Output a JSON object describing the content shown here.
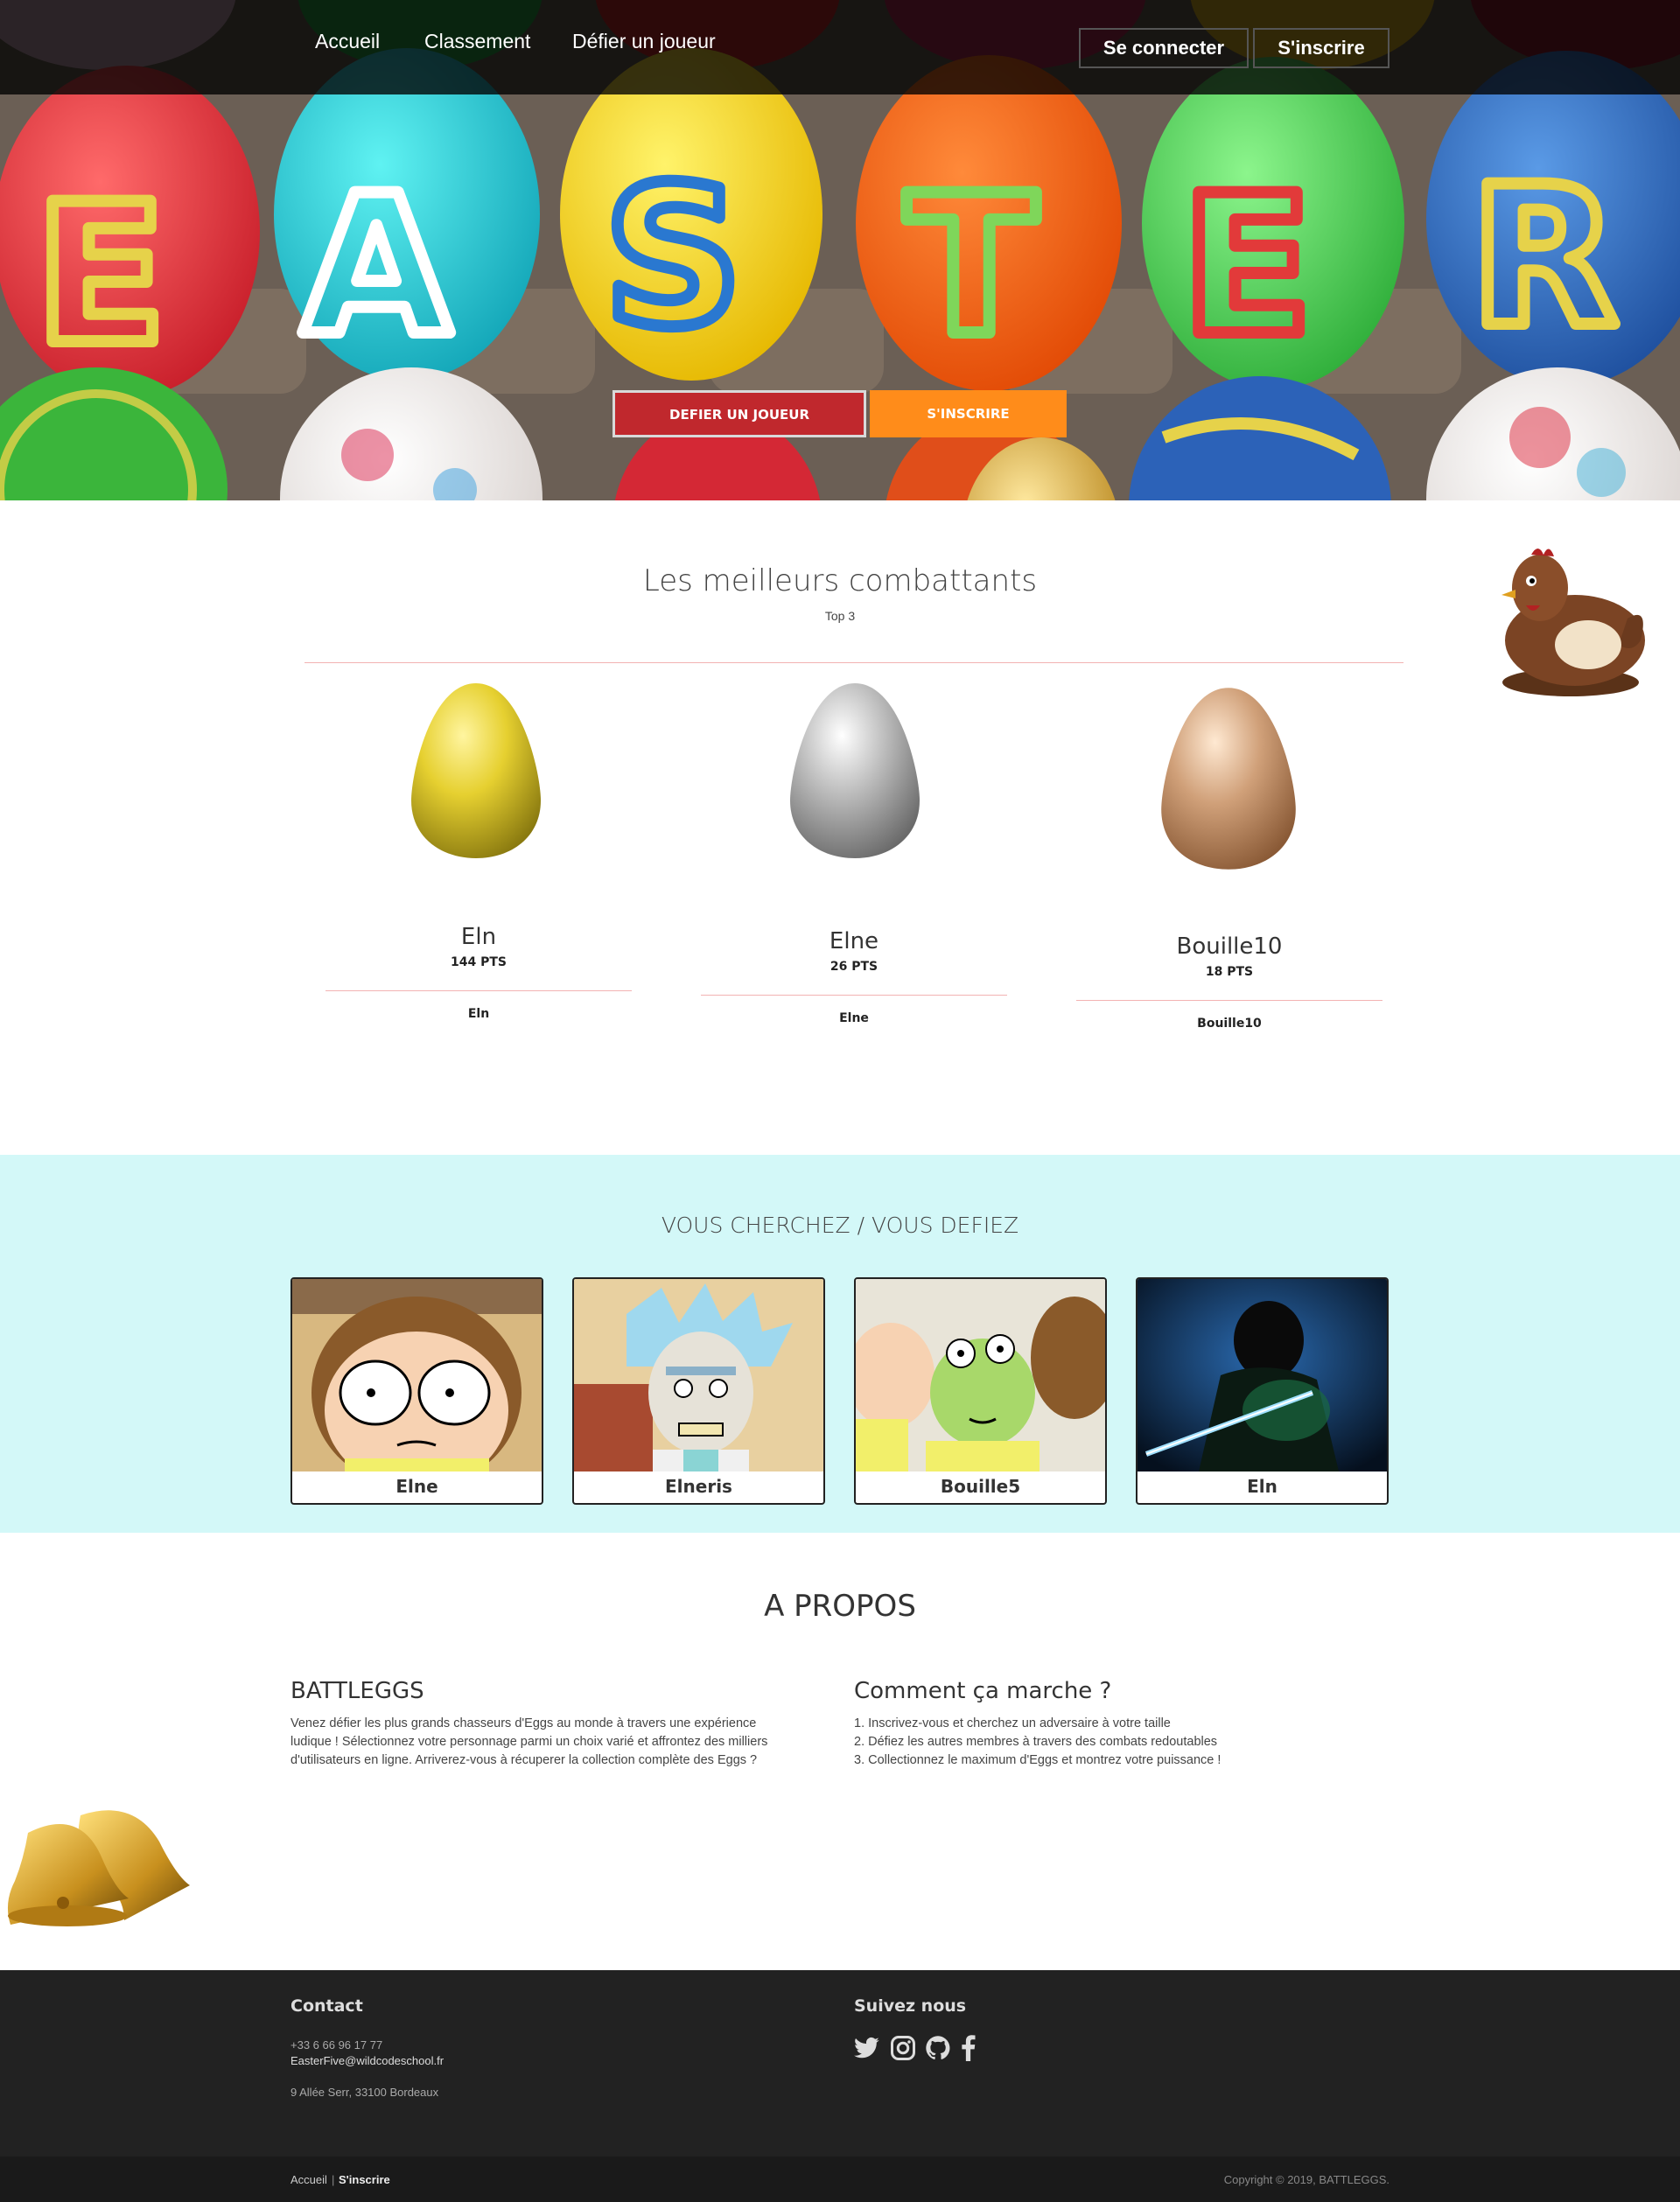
{
  "nav": {
    "links": [
      "Accueil",
      "Classement",
      "Défier un joueur"
    ],
    "login_label": "Se connecter",
    "signup_label": "S'inscrire"
  },
  "hero": {
    "challenge_label": "DEFIER UN JOUEUR",
    "signup_label": "S'INSCRIRE",
    "egg_letters": [
      "E",
      "A",
      "S",
      "T",
      "E",
      "R"
    ]
  },
  "top": {
    "title": "Les meilleurs combattants",
    "subtitle": "Top 3",
    "players": [
      {
        "name": "Eln",
        "points": "144 PTS",
        "sub": "Eln",
        "medal": "gold"
      },
      {
        "name": "Elne",
        "points": "26 PTS",
        "sub": "Elne",
        "medal": "silver"
      },
      {
        "name": "Bouille10",
        "points": "18 PTS",
        "sub": "Bouille10",
        "medal": "bronze"
      }
    ]
  },
  "challenge": {
    "title": "VOUS CHERCHEZ / VOUS DEFIEZ",
    "cards": [
      {
        "name": "Elne"
      },
      {
        "name": "Elneris"
      },
      {
        "name": "Bouille5"
      },
      {
        "name": "Eln"
      }
    ]
  },
  "about": {
    "title": "A PROPOS",
    "left_heading": "BATTLEGGS",
    "left_lines": [
      "Venez défier les plus grands chasseurs d'Eggs au monde à travers une expérience",
      "ludique ! Sélectionnez votre personnage parmi un choix varié et affrontez des milliers",
      "d'utilisateurs en ligne. Arriverez-vous à récuperer la collection complète des Eggs ?"
    ],
    "right_heading": "Comment ça marche ?",
    "right_lines": [
      "1. Inscrivez-vous et cherchez un adversaire à votre taille",
      "2. Défiez les autres membres à travers des combats redoutables",
      "3. Collectionnez le maximum d'Eggs et montrez votre puissance !"
    ]
  },
  "footer": {
    "contact_title": "Contact",
    "phone": "+33 6 66 96 17 77",
    "email": "EasterFive@wildcodeschool.fr",
    "address": "9 Allée Serr, 33100 Bordeaux",
    "follow_title": "Suivez nous",
    "social_icons": [
      "twitter-icon",
      "instagram-icon",
      "github-icon",
      "facebook-icon"
    ],
    "bottom_link_home": "Accueil",
    "bottom_separator": "|",
    "bottom_link_signup": "S'inscrire",
    "copyright": "Copyright © 2019, BATTLEGGS."
  },
  "colors": {
    "nav_bg": "#1c1c1c",
    "accent_red": "#c0282d",
    "accent_orange": "#ff8c1a",
    "challenge_bg": "#d3f8f8",
    "footer_bg": "#222222",
    "divider": "#f3b3b3"
  }
}
